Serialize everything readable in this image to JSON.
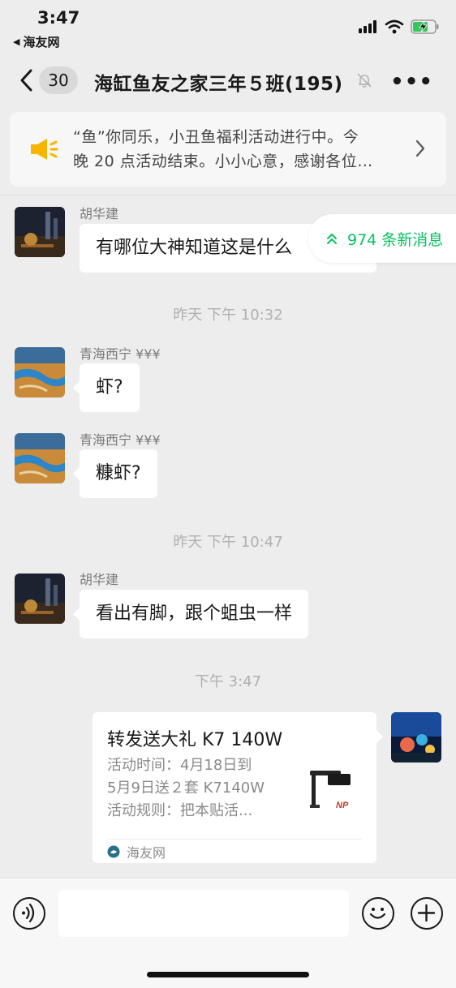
{
  "status_bar": {
    "time": "3:47",
    "back_app": "海友网",
    "icons": [
      "signal-icon",
      "wifi-icon",
      "battery-charging-icon"
    ]
  },
  "nav": {
    "back_icon": "chevron-left-icon",
    "unread_count": "30",
    "title": "海缸鱼友之家三年５班(195)",
    "mute_icon": "bell-muted-icon",
    "more_icon": "more-dots-icon",
    "more_label": "•••"
  },
  "notice": {
    "icon": "speaker-icon",
    "line1": "“鱼”你同乐，小丑鱼福利活动进行中。今",
    "line2": "晚 20 点活动结束。小小心意，感谢各位…"
  },
  "new_messages": {
    "label": "974 条新消息",
    "icon": "double-chevron-up-icon"
  },
  "messages": [
    {
      "sender": "胡华建",
      "text": "有哪位大神知道这是什么"
    },
    {
      "timestamp": "昨天 下午 10:32"
    },
    {
      "sender": "青海西宁 ¥¥¥",
      "text": "虾?"
    },
    {
      "sender": "青海西宁 ¥¥¥",
      "text": "糠虾?"
    },
    {
      "timestamp": "昨天 下午 10:47"
    },
    {
      "sender": "胡华建",
      "text": "看出有脚，跟个蛆虫一样"
    },
    {
      "timestamp": "下午 3:47"
    }
  ],
  "link_card": {
    "title": "转发送大礼 K7 140W",
    "desc_line1": "活动时间：4月18日到",
    "desc_line2": "5月9日送２套 K7140W",
    "desc_line3": "活动规则：把本贴活...",
    "source": "海友网",
    "thumb_logo": "NP"
  },
  "input_bar": {
    "voice_icon": "voice-icon",
    "emoji_icon": "emoji-icon",
    "plus_icon": "plus-icon"
  },
  "colors": {
    "background": "#ededed",
    "accent_green": "#07c160",
    "bubble": "#ffffff"
  }
}
